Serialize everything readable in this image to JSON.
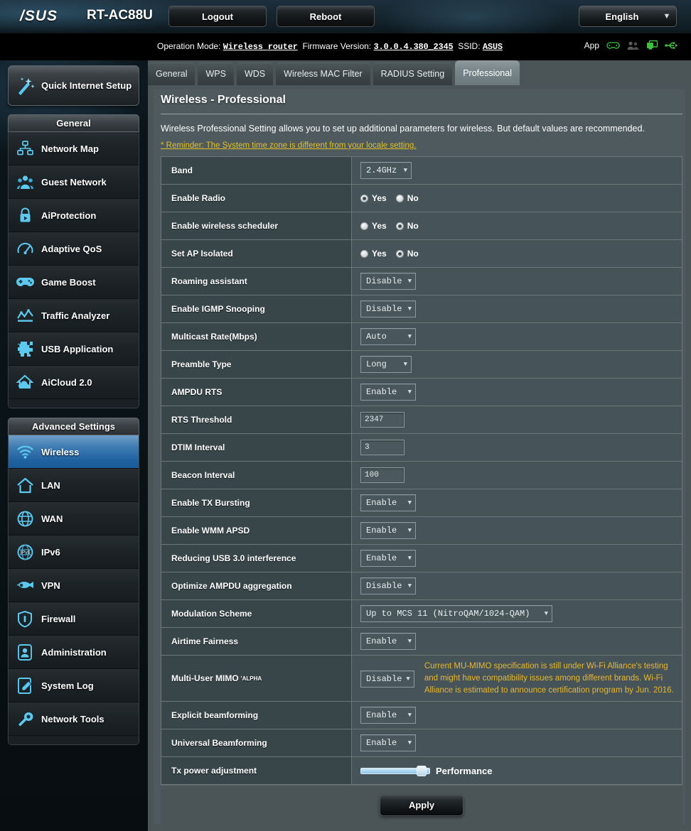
{
  "header": {
    "brand": "/SUS",
    "model": "RT-AC88U",
    "logout_label": "Logout",
    "reboot_label": "Reboot",
    "language": "English",
    "accent_color": "#2063a2",
    "link_color": "#e2c02a"
  },
  "infobar": {
    "operation_mode_label": "Operation Mode:",
    "operation_mode_value": "Wireless router",
    "firmware_label": "Firmware Version:",
    "firmware_value": "3.0.0.4.380_2345",
    "ssid_label": "SSID:",
    "ssid_value": "ASUS",
    "app_label": "App",
    "icons": [
      {
        "name": "gamepad-icon",
        "color": "#3fbf3f"
      },
      {
        "name": "users-icon",
        "color": "#5a5a5a"
      },
      {
        "name": "display-icon",
        "color": "#3fbf3f"
      },
      {
        "name": "usb-icon",
        "color": "#3fbf3f"
      }
    ]
  },
  "sidebar": {
    "quick_setup": "Quick Internet Setup",
    "groups": [
      {
        "title": "General",
        "items": [
          {
            "label": "Network Map",
            "icon": "network-map-icon",
            "active": false
          },
          {
            "label": "Guest Network",
            "icon": "guest-network-icon",
            "active": false
          },
          {
            "label": "AiProtection",
            "icon": "lock-icon",
            "active": false
          },
          {
            "label": "Adaptive QoS",
            "icon": "gauge-icon",
            "active": false
          },
          {
            "label": "Game Boost",
            "icon": "gamepad-icon",
            "active": false
          },
          {
            "label": "Traffic Analyzer",
            "icon": "chart-icon",
            "active": false
          },
          {
            "label": "USB Application",
            "icon": "puzzle-icon",
            "active": false
          },
          {
            "label": "AiCloud 2.0",
            "icon": "cloud-home-icon",
            "active": false
          }
        ]
      },
      {
        "title": "Advanced Settings",
        "items": [
          {
            "label": "Wireless",
            "icon": "wifi-icon",
            "active": true
          },
          {
            "label": "LAN",
            "icon": "home-icon",
            "active": false
          },
          {
            "label": "WAN",
            "icon": "globe-icon",
            "active": false
          },
          {
            "label": "IPv6",
            "icon": "ipv6-globe-icon",
            "active": false
          },
          {
            "label": "VPN",
            "icon": "vpn-key-icon",
            "active": false
          },
          {
            "label": "Firewall",
            "icon": "shield-icon",
            "active": false
          },
          {
            "label": "Administration",
            "icon": "user-icon",
            "active": false
          },
          {
            "label": "System Log",
            "icon": "log-edit-icon",
            "active": false
          },
          {
            "label": "Network Tools",
            "icon": "tools-icon",
            "active": false
          }
        ]
      }
    ]
  },
  "tabs": [
    {
      "label": "General",
      "active": false
    },
    {
      "label": "WPS",
      "active": false
    },
    {
      "label": "WDS",
      "active": false
    },
    {
      "label": "Wireless MAC Filter",
      "active": false
    },
    {
      "label": "RADIUS Setting",
      "active": false
    },
    {
      "label": "Professional",
      "active": true
    }
  ],
  "panel": {
    "title": "Wireless - Professional",
    "description": "Wireless Professional Setting allows you to set up additional parameters for wireless. But default values are recommended.",
    "reminder": "* Reminder: The System time zone is different from your locale setting.",
    "apply_label": "Apply"
  },
  "settings": [
    {
      "label": "Band",
      "type": "dropdown",
      "value": "2.4GHz",
      "width": "w72"
    },
    {
      "label": "Enable Radio",
      "type": "radio",
      "options": [
        "Yes",
        "No"
      ],
      "selected": "Yes"
    },
    {
      "label": "Enable wireless scheduler",
      "type": "radio",
      "options": [
        "Yes",
        "No"
      ],
      "selected": "No"
    },
    {
      "label": "Set AP Isolated",
      "type": "radio",
      "options": [
        "Yes",
        "No"
      ],
      "selected": "No"
    },
    {
      "label": "Roaming assistant",
      "type": "dropdown",
      "value": "Disable",
      "width": "w78"
    },
    {
      "label": "Enable IGMP Snooping",
      "type": "dropdown",
      "value": "Disable",
      "width": "w78"
    },
    {
      "label": "Multicast Rate(Mbps)",
      "type": "dropdown",
      "value": "Auto",
      "width": "w78"
    },
    {
      "label": "Preamble Type",
      "type": "dropdown",
      "value": "Long",
      "width": "w72"
    },
    {
      "label": "AMPDU RTS",
      "type": "dropdown",
      "value": "Enable",
      "width": "w78"
    },
    {
      "label": "RTS Threshold",
      "type": "text",
      "value": "2347"
    },
    {
      "label": "DTIM Interval",
      "type": "text",
      "value": "3"
    },
    {
      "label": "Beacon Interval",
      "type": "text",
      "value": "100"
    },
    {
      "label": "Enable TX Bursting",
      "type": "dropdown",
      "value": "Enable",
      "width": "w78"
    },
    {
      "label": "Enable WMM APSD",
      "type": "dropdown",
      "value": "Enable",
      "width": "w78"
    },
    {
      "label": "Reducing USB 3.0 interference",
      "type": "dropdown",
      "value": "Enable",
      "width": "w78"
    },
    {
      "label": "Optimize AMPDU aggregation",
      "type": "dropdown",
      "value": "Disable",
      "width": "w78"
    },
    {
      "label": "Modulation Scheme",
      "type": "dropdown",
      "value": "Up to MCS 11 (NitroQAM/1024-QAM)",
      "width": "w270"
    },
    {
      "label": "Airtime Fairness",
      "type": "dropdown",
      "value": "Enable",
      "width": "w78"
    },
    {
      "label": "Multi-User MIMO",
      "sup": "'ALPHA",
      "type": "dropdown-note",
      "value": "Disable",
      "width": "w78",
      "note": "Current MU-MIMO specification is still under Wi-Fi Alliance's testing and might have compatibility issues among different brands. Wi-Fi Alliance is estimated to announce certification program by Jun. 2016."
    },
    {
      "label": "Explicit beamforming",
      "type": "dropdown",
      "value": "Enable",
      "width": "w78"
    },
    {
      "label": "Universal Beamforming",
      "type": "dropdown",
      "value": "Enable",
      "width": "w78"
    },
    {
      "label": "Tx power adjustment",
      "type": "slider",
      "value": "Performance",
      "percent": 82
    }
  ]
}
